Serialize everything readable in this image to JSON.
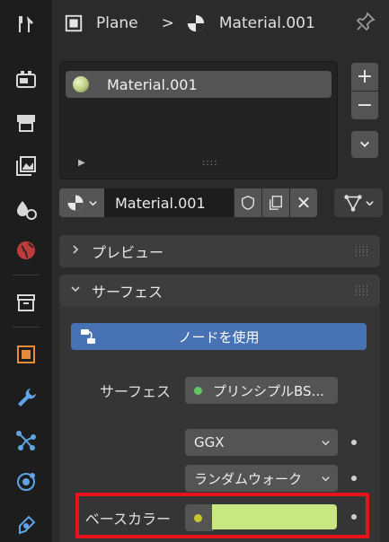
{
  "header": {
    "object_name": "Plane",
    "separator": ">",
    "material_name": "Material.001"
  },
  "tabs": [
    "tool",
    "render",
    "output",
    "view-layer",
    "scene",
    "world",
    "collection",
    "object",
    "modifiers",
    "particles",
    "physics"
  ],
  "slots": {
    "items": [
      {
        "label": "Material.001"
      }
    ],
    "add_label": "+",
    "remove_label": "−",
    "menu_label": "⌄"
  },
  "datablock": {
    "name": "Material.001",
    "unlink_label": "✕"
  },
  "panels": {
    "preview": {
      "title": "プレビュー"
    },
    "surface": {
      "title": "サーフェス"
    }
  },
  "surface": {
    "use_nodes_label": "ノードを使用",
    "surface_label": "サーフェス",
    "surface_value": "プリンシプルBS...",
    "distribution_value": "GGX",
    "subsurface_method_value": "ランダムウォーク",
    "base_color_label": "ベースカラー",
    "base_color_hex": "#c8e783"
  },
  "colors": {
    "accent_blue": "#4772b3",
    "highlight_red": "#e8141c",
    "socket_green": "#63c763",
    "socket_yellow": "#c7c729"
  }
}
